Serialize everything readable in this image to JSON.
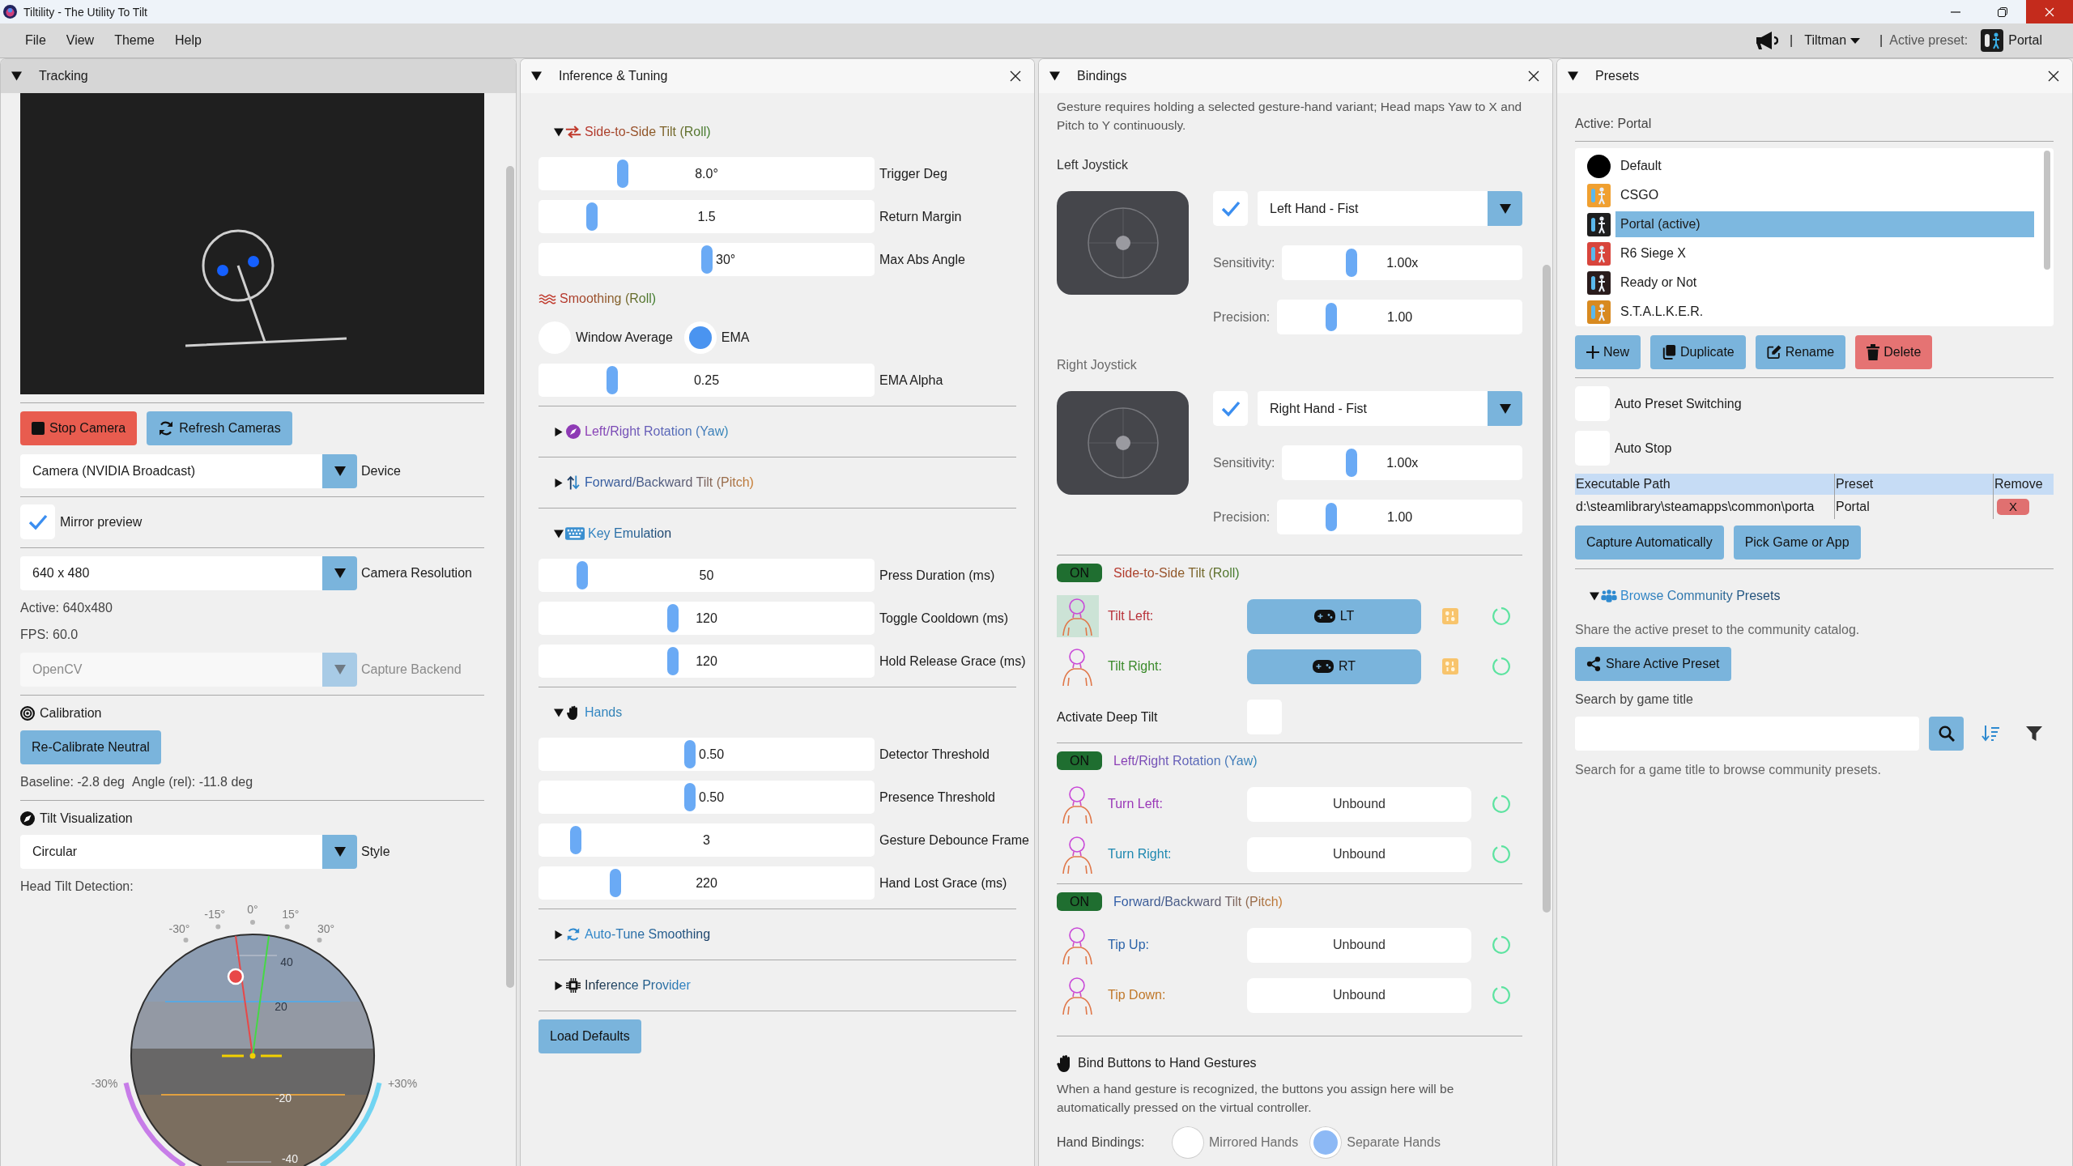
{
  "window": {
    "title": "Tiltility - The Utility To Tilt"
  },
  "menu": [
    "File",
    "View",
    "Theme",
    "Help"
  ],
  "toolbar": {
    "separators": [
      "|",
      "|"
    ],
    "user": "Tiltman",
    "active_label": "Active preset:",
    "active_preset": "Portal"
  },
  "tracking": {
    "title": "Tracking",
    "expanded": true,
    "focused": true,
    "closable": false,
    "buttons": [
      {
        "label": "Stop Camera",
        "kind": "stop"
      },
      {
        "label": "Refresh Cameras",
        "kind": "refresh"
      }
    ],
    "device": {
      "value": "Camera (NVIDIA Broadcast)",
      "label": "Device"
    },
    "mirror": {
      "label": "Mirror preview",
      "checked": true
    },
    "resolution": {
      "value": "640 x 480",
      "label": "Camera Resolution"
    },
    "info": [
      "Active: 640x480",
      "FPS: 60.0"
    ],
    "backend": {
      "value": "OpenCV",
      "label": "Capture Backend",
      "disabled": true
    },
    "calibration": {
      "title": "Calibration",
      "button": "Re-Calibrate Neutral",
      "baseline": "Baseline: -2.8 deg",
      "angle": "Angle (rel): -11.8 deg"
    },
    "visualization": {
      "title": "Tilt Visualization",
      "style": {
        "value": "Circular",
        "label": "Style"
      },
      "caption": "Head Tilt Detection:",
      "dial": {
        "angle_ticks": [
          "-30°",
          "-15°",
          "0°",
          "15°",
          "30°"
        ],
        "pitch_ticks": [
          "40",
          "20",
          "-20",
          "-40"
        ],
        "left_limit": "-30%",
        "right_limit": "+30%"
      }
    }
  },
  "tuning": {
    "title": "Inference & Tuning",
    "expanded": true,
    "focused": false,
    "closable": true,
    "sections": [
      {
        "kind": "roll",
        "title": "Side-to-Side Tilt (Roll)",
        "expanded": true,
        "rows": [
          {
            "kind": "slider",
            "label": "Trigger Deg",
            "value": "8.0°",
            "level": 0.25
          },
          {
            "kind": "slider",
            "label": "Return Margin",
            "value": "1.5",
            "level": 0.16
          },
          {
            "kind": "slider",
            "label": "Max Abs Angle",
            "value": "30°",
            "level": 0.5
          },
          {
            "kind": "heading",
            "label": "Smoothing (Roll)"
          },
          {
            "kind": "radios",
            "options": [
              {
                "label": "Window Average",
                "selected": false
              },
              {
                "label": "EMA",
                "selected": true
              }
            ]
          },
          {
            "kind": "slider",
            "label": "EMA Alpha",
            "value": "0.25",
            "level": 0.22
          }
        ]
      },
      {
        "kind": "yaw",
        "title": "Left/Right Rotation (Yaw)",
        "expanded": false
      },
      {
        "kind": "pitch",
        "title": "Forward/Backward Tilt (Pitch)",
        "expanded": false
      },
      {
        "kind": "keys",
        "title": "Key Emulation",
        "expanded": true,
        "rows": [
          {
            "kind": "slider",
            "label": "Press Duration (ms)",
            "value": "50",
            "level": 0.13
          },
          {
            "kind": "slider",
            "label": "Toggle Cooldown (ms)",
            "value": "120",
            "level": 0.4
          },
          {
            "kind": "slider",
            "label": "Hold Release Grace (ms)",
            "value": "120",
            "level": 0.4
          }
        ]
      },
      {
        "kind": "hands",
        "title": "Hands",
        "expanded": true,
        "rows": [
          {
            "kind": "slider",
            "label": "Detector Threshold",
            "value": "0.50",
            "level": 0.45
          },
          {
            "kind": "slider",
            "label": "Presence Threshold",
            "value": "0.50",
            "level": 0.45
          },
          {
            "kind": "slider",
            "label": "Gesture Debounce Frame",
            "value": "3",
            "level": 0.11
          },
          {
            "kind": "slider",
            "label": "Hand Lost Grace (ms)",
            "value": "220",
            "level": 0.23
          }
        ]
      },
      {
        "kind": "autotune",
        "title": "Auto-Tune Smoothing",
        "expanded": false
      },
      {
        "kind": "provider",
        "title": "Inference Provider",
        "expanded": false
      }
    ],
    "button": "Load Defaults"
  },
  "bindings": {
    "title": "Bindings",
    "expanded": true,
    "focused": false,
    "closable": true,
    "intro": "Gesture requires holding a selected gesture-hand variant; Head maps Yaw to X and Pitch to Y continuously.",
    "joysticks": [
      {
        "title": "Left Joystick",
        "active": true,
        "enabled": true,
        "gesture": "Left Hand - Fist",
        "sensitivity": {
          "label": "Sensitivity:",
          "value": "1.00x",
          "level": 0.29
        },
        "precision": {
          "label": "Precision:",
          "value": "1.00",
          "level": 0.22
        }
      },
      {
        "title": "Right Joystick",
        "active": false,
        "enabled": true,
        "gesture": "Right Hand - Fist",
        "sensitivity": {
          "label": "Sensitivity:",
          "value": "1.00x",
          "level": 0.29
        },
        "precision": {
          "label": "Precision:",
          "value": "1.00",
          "level": 0.22
        }
      }
    ],
    "axes": [
      {
        "kind": "roll",
        "on": true,
        "status": "ON",
        "title": "Side-to-Side Tilt (Roll)",
        "actions": [
          {
            "label": "Tilt Left:",
            "color": "#b8323a",
            "active": true,
            "bound": true,
            "binding": "LT"
          },
          {
            "label": "Tilt Right:",
            "color": "#3a8a2a",
            "active": false,
            "bound": true,
            "binding": "RT"
          }
        ],
        "extra": {
          "label": "Activate Deep Tilt",
          "checked": false
        }
      },
      {
        "kind": "yaw",
        "on": true,
        "status": "ON",
        "title": "Left/Right Rotation (Yaw)",
        "actions": [
          {
            "label": "Turn Left:",
            "color": "#9a38b8",
            "active": false,
            "bound": false,
            "binding": "Unbound"
          },
          {
            "label": "Turn Right:",
            "color": "#1e88b0",
            "active": false,
            "bound": false,
            "binding": "Unbound"
          }
        ]
      },
      {
        "kind": "pitch",
        "on": true,
        "status": "ON",
        "title": "Forward/Backward Tilt (Pitch)",
        "actions": [
          {
            "label": "Tip Up:",
            "color": "#2a62a8",
            "active": false,
            "bound": false,
            "binding": "Unbound"
          },
          {
            "label": "Tip Down:",
            "color": "#c0782a",
            "active": false,
            "bound": false,
            "binding": "Unbound"
          }
        ]
      }
    ],
    "hand_gestures": {
      "title": "Bind Buttons to Hand Gestures",
      "text": "When a hand gesture is recognized, the buttons you assign here will be automatically pressed on the virtual controller.",
      "mode_label": "Hand Bindings:",
      "modes": [
        {
          "label": "Mirrored Hands",
          "selected": false
        },
        {
          "label": "Separate Hands",
          "selected": true
        }
      ]
    }
  },
  "presets": {
    "title": "Presets",
    "expanded": true,
    "focused": false,
    "closable": true,
    "active_text": "Active: Portal",
    "items": [
      {
        "name": "Default",
        "kind": "dot",
        "color": "#000000",
        "selected": false
      },
      {
        "name": "CSGO",
        "kind": "tile",
        "color": "#f0a030",
        "selected": false
      },
      {
        "name": "Portal (active)",
        "kind": "tile",
        "color": "#1e1e1e",
        "selected": true
      },
      {
        "name": "R6 Siege X",
        "kind": "tile",
        "color": "#d8453c",
        "selected": false
      },
      {
        "name": "Ready or Not",
        "kind": "tile",
        "color": "#2a1c1c",
        "selected": false
      },
      {
        "name": "S.T.A.L.K.E.R.",
        "kind": "tile",
        "color": "#d88a20",
        "selected": false
      }
    ],
    "buttons": [
      {
        "label": "New",
        "kind": "new"
      },
      {
        "label": "Duplicate",
        "kind": "duplicate"
      },
      {
        "label": "Rename",
        "kind": "rename"
      },
      {
        "label": "Delete",
        "kind": "delete"
      }
    ],
    "toggles": [
      {
        "label": "Auto Preset Switching",
        "checked": false
      },
      {
        "label": "Auto Stop",
        "checked": false
      }
    ],
    "table": {
      "columns": [
        "Executable Path",
        "Preset",
        "Remove"
      ],
      "rows": [
        {
          "path": "d:\\steamlibrary\\steamapps\\common\\porta",
          "preset": "Portal",
          "remove": "X"
        }
      ]
    },
    "capture_buttons": [
      "Capture Automatically",
      "Pick Game or App"
    ],
    "community": {
      "title": "Browse Community Presets",
      "expanded": true,
      "share_text": "Share the active preset to the community catalog.",
      "share_button": "Share Active Preset",
      "search_label": "Search by game title",
      "hint": "Search for a game title to browse community presets."
    }
  }
}
